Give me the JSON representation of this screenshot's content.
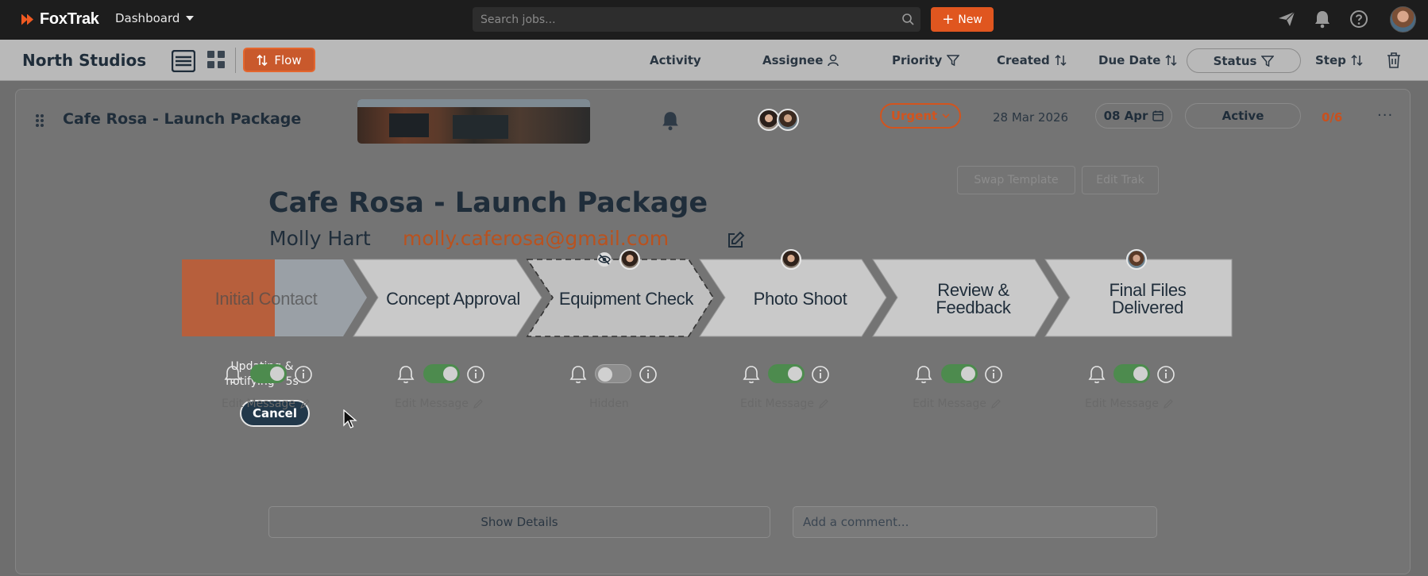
{
  "app": {
    "brand": "FoxTrak",
    "nav_label": "Dashboard"
  },
  "search": {
    "placeholder": "Search jobs..."
  },
  "new_button": {
    "plus": "+",
    "label": "New"
  },
  "workspace": {
    "name": "North Studios",
    "flow_label": "Flow"
  },
  "columns": {
    "activity": "Activity",
    "assignee": "Assignee",
    "priority": "Priority",
    "created": "Created",
    "due_date": "Due Date",
    "status": "Status",
    "step": "Step"
  },
  "job": {
    "title": "Cafe Rosa - Launch Package",
    "priority": "Urgent",
    "created": "28 Mar 2026",
    "due": "08 Apr",
    "status": "Active",
    "progress": "0/6",
    "more": "···",
    "client_name": "Molly Hart",
    "client_email": "molly.caferosa@gmail.com",
    "swap_template": "Swap Template",
    "edit_trak": "Edit Trak"
  },
  "steps": [
    {
      "label": "Initial Contact",
      "edit_message": "Edit Message",
      "toggle_on": true
    },
    {
      "label": "Concept Approval",
      "edit_message": "Edit Message",
      "toggle_on": true
    },
    {
      "label": "Equipment Check",
      "edit_message": "Hidden",
      "toggle_on": false
    },
    {
      "label": "Photo Shoot",
      "edit_message": "Edit Message",
      "toggle_on": true
    },
    {
      "label_line1": "Review &",
      "label_line2": "Feedback",
      "edit_message": "Edit Message",
      "toggle_on": true
    },
    {
      "label_line1": "Final Files",
      "label_line2": "Delivered",
      "edit_message": "Edit Message",
      "toggle_on": true
    }
  ],
  "overlay": {
    "message": "Updating & notifying - 5s",
    "cancel": "Cancel"
  },
  "footer": {
    "show_details": "Show Details",
    "comment_placeholder": "Add a comment..."
  },
  "colors": {
    "accent": "#e0561f",
    "toggle_on": "#4d8b4e",
    "urgent": "#d2541e"
  },
  "icons": [
    "logo-icon",
    "search-icon",
    "send-icon",
    "bell-icon",
    "help-icon",
    "list-view-icon",
    "grid-view-icon",
    "sort-icon",
    "person-icon",
    "filter-icon",
    "trash-icon",
    "drag-handle-icon",
    "calendar-icon",
    "edit-icon",
    "eye-off-icon",
    "info-icon",
    "pencil-icon",
    "cursor-icon"
  ]
}
